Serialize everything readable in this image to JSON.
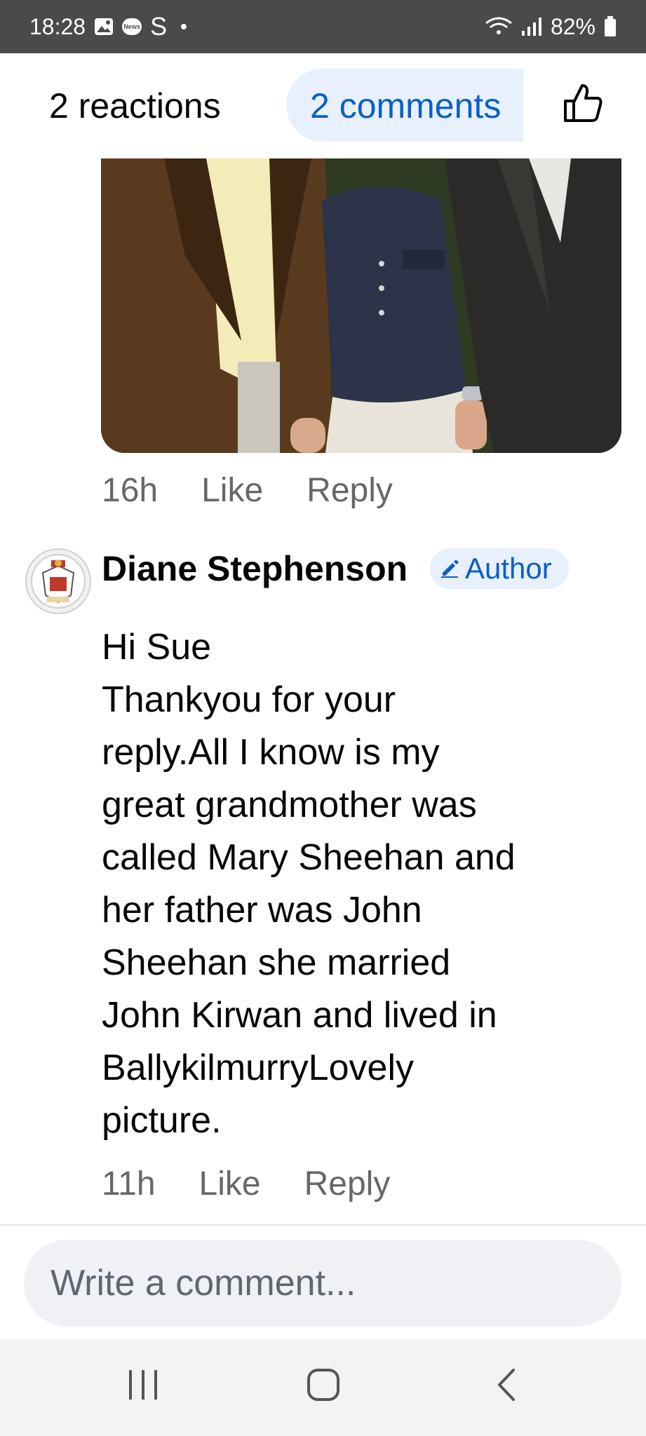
{
  "status_bar": {
    "time": "18:28",
    "news_badge": "News",
    "app_glyph": "S",
    "battery": "82%",
    "icons": [
      "gallery-icon",
      "news-icon",
      "skype-icon",
      "dot-icon",
      "wifi-icon",
      "signal-icon",
      "battery-icon"
    ]
  },
  "header": {
    "reactions": "2 reactions",
    "comments": "2 comments",
    "like_icon": "thumbs-up-icon"
  },
  "first_comment": {
    "time": "16h",
    "like_label": "Like",
    "reply_label": "Reply"
  },
  "author_comment": {
    "name": "Diane Stephenson",
    "badge": "Author",
    "lines": [
      "Hi Sue",
      "Thankyou for your",
      "reply.All I know is my",
      "great grandmother was",
      "called Mary Sheehan and",
      "her father was John",
      "Sheehan she married",
      "John Kirwan and lived in",
      "BallykilmurryLovely",
      "picture."
    ],
    "time": "11h",
    "like_label": "Like",
    "reply_label": "Reply"
  },
  "composer": {
    "placeholder": "Write a comment..."
  },
  "nav": {
    "icons": [
      "recent-apps-icon",
      "home-icon",
      "back-icon"
    ]
  },
  "colors": {
    "accent": "#0a5fc9",
    "pill_bg": "#e7f0fc",
    "meta_text": "#65676b",
    "status_bar": "#4a4a4a"
  }
}
